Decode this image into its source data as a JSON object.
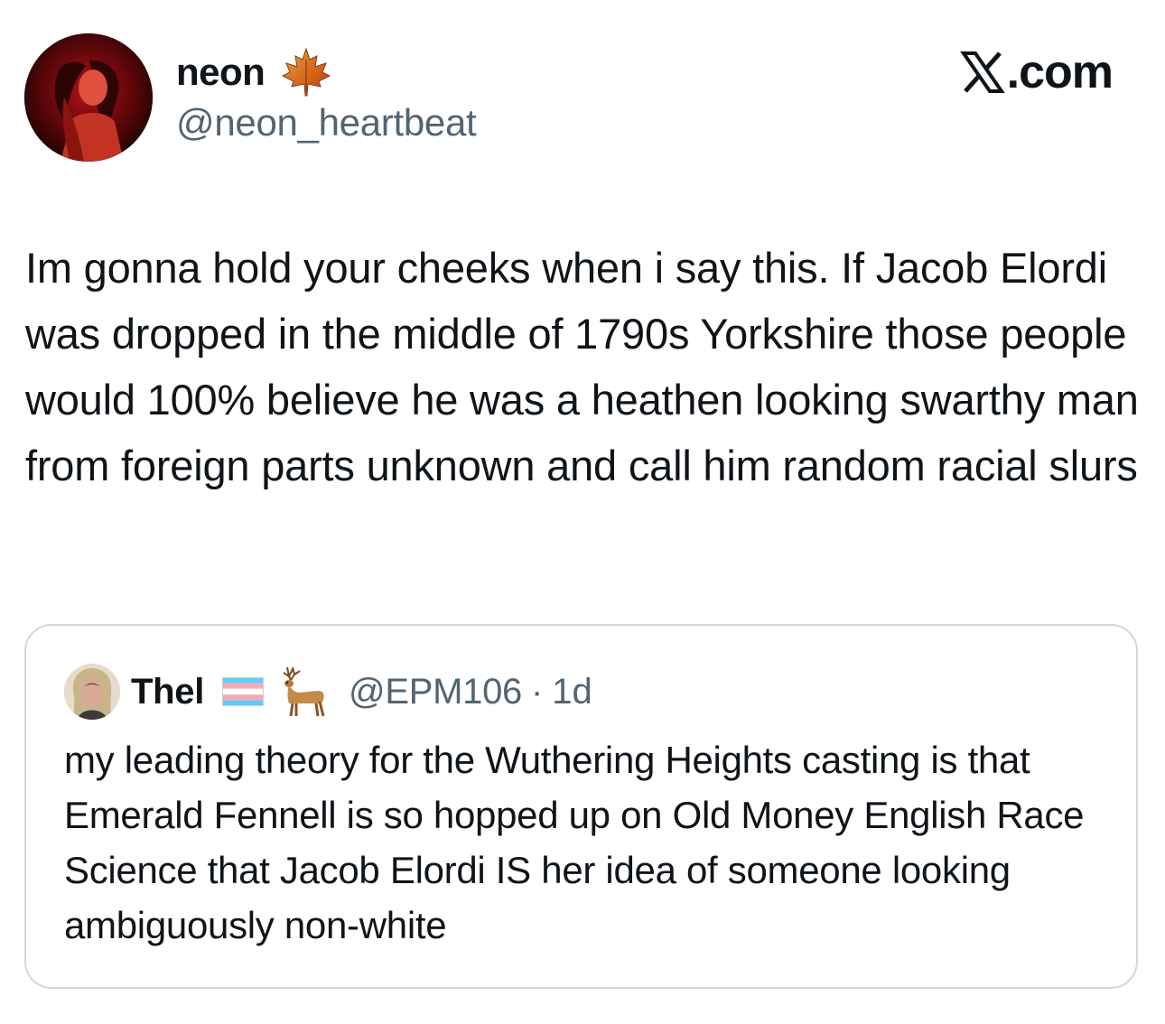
{
  "tweet": {
    "author": {
      "display_name": "neon",
      "handle": "@neon_heartbeat",
      "badge_icon": "maple-leaf-icon"
    },
    "platform_label": ".com",
    "platform_icon": "x-logo-icon",
    "text": "Im gonna hold your cheeks when i say this. If Jacob Elordi was dropped in the middle of 1790s Yorkshire those people would 100% believe he was a heathen looking swarthy man from foreign parts unknown and call him random racial slurs"
  },
  "quoted_tweet": {
    "author": {
      "display_name": "Thel",
      "handle": "@EPM106",
      "badge_icons": [
        "transgender-flag-icon",
        "deer-icon"
      ]
    },
    "separator": "·",
    "time": "1d",
    "text": "my leading theory for the Wuthering Heights casting is that Emerald Fennell is so hopped up on Old Money English Race Science that Jacob Elordi IS her idea of someone looking ambiguously non-white"
  },
  "colors": {
    "text_primary": "#0f1419",
    "text_secondary": "#536471",
    "border": "#cfd9de",
    "flag_blue": "#5bcefa",
    "flag_pink": "#f5a9b8"
  }
}
